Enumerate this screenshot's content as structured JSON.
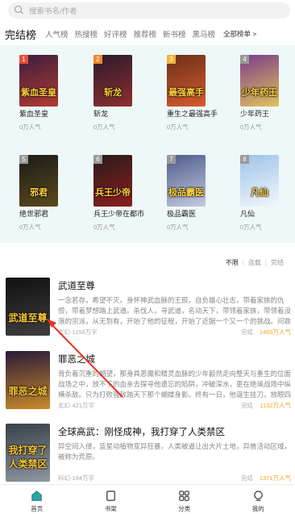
{
  "search": {
    "placeholder": "搜索书名/作者"
  },
  "rank": {
    "title": "完结榜",
    "tabs": [
      "人气榜",
      "热搜榜",
      "好评榜",
      "推荐榜",
      "新书榜",
      "黑马榜"
    ],
    "all_label": "全部榜单 >"
  },
  "grid": [
    {
      "rank": "1",
      "name": "紫血圣皇",
      "cover_text": "紫血圣皇",
      "pop": "0万人气",
      "rank_color": "#e94b3c",
      "bg": [
        "#3a1d3f",
        "#b33b2f"
      ]
    },
    {
      "rank": "2",
      "name": "斩龙",
      "cover_text": "斩龙",
      "pop": "0万人气",
      "rank_color": "#f08a2a",
      "bg": [
        "#2b1a2e",
        "#8c2f2f"
      ]
    },
    {
      "rank": "3",
      "name": "重生之最强高手",
      "cover_text": "最强高手",
      "pop": "0万人气",
      "rank_color": "#f3b43a",
      "bg": [
        "#6a2f1b",
        "#d65b2c"
      ]
    },
    {
      "rank": "4",
      "name": "少年药王",
      "cover_text": "少年药王",
      "pop": "0万人气",
      "rank_color": "#999999",
      "bg": [
        "#7a3c8c",
        "#e2c35a"
      ]
    },
    {
      "rank": "5",
      "name": "绝世邪君",
      "cover_text": "邪君",
      "pop": "0万人气",
      "rank_color": "#999999",
      "bg": [
        "#1a1a1a",
        "#5b4a1c"
      ]
    },
    {
      "rank": "6",
      "name": "兵王少帝在都市",
      "cover_text": "兵王少帝",
      "pop": "0万人气",
      "rank_color": "#999999",
      "bg": [
        "#2a1a1a",
        "#8c1f1f"
      ]
    },
    {
      "rank": "7",
      "name": "极品霸医",
      "cover_text": "极品霸医",
      "pop": "0万人气",
      "rank_color": "#999999",
      "bg": [
        "#4c5b8a",
        "#c7cbe0"
      ]
    },
    {
      "rank": "8",
      "name": "凡仙",
      "cover_text": "凡仙",
      "pop": "0万人气",
      "rank_color": "#999999",
      "bg": [
        "#9ec3e8",
        "#f3f7fb"
      ]
    }
  ],
  "filter": {
    "options": [
      "不限",
      "连载",
      "完结"
    ],
    "selected": "不限"
  },
  "list": [
    {
      "title": "武道至尊",
      "cover_text": "武道至尊",
      "desc": "一念若存，希望不灭。身怀神武血脉的王辰，自负雄心壮志，带着家族的仇恨，带着梦想踏上武道。杀伐人，寻武道，名动天下，带领着家族，带领着没落的宗派，从无到有，开始了他的征程，开始了近据一个又一个的挑战。问鼎之路，何其困难。",
      "meta": "玄幻·1156万字",
      "status": "完结",
      "pop": "1465万人气",
      "bg": [
        "#111111",
        "#3d3d3d"
      ]
    },
    {
      "title": "罪恶之城",
      "cover_text": "罪恶之城",
      "desc": "背负着沉重的期望，那身具恶魔和精灵血脉的少年毅然走向整天与重生的位面战场之中，放不下的血亲去探寻他遗忘的陷阱，冲破深水，更在绝境战场中纵横杀敌。只为打败强敌踏天下那个蝴蝶身影。终有一日，他诞生挂刀，放眼四城，那",
      "meta": "玄幻·421万字",
      "status": "完结",
      "pop": "1132万人气",
      "bg": [
        "#2a1a3a",
        "#c98a2a"
      ]
    },
    {
      "title": "全球高武：刚怪成神，我打穿了人类禁区",
      "cover_text": "我打穿了人类禁区",
      "desc": "异空间入侵，蓝星动植物变异狂暴，人类被逼让出大片土地，异兽活动区域，被称为荒原。",
      "meta": "科幻·194万字",
      "status": "完结",
      "pop": "1371万人气",
      "bg": [
        "#3a4148",
        "#8c97a1"
      ]
    }
  ],
  "nav": [
    {
      "label": "首页",
      "icon": "home-icon",
      "active": true
    },
    {
      "label": "书架",
      "icon": "bookshelf-icon",
      "active": false
    },
    {
      "label": "分类",
      "icon": "category-grid-icon",
      "active": false
    },
    {
      "label": "我的",
      "icon": "profile-icon",
      "active": false
    }
  ],
  "colors": {
    "panel_bg": "#eef8f8",
    "popularity": "#f5a623",
    "arrow": "#e8332a",
    "nav_active": "#2aa8a8"
  }
}
